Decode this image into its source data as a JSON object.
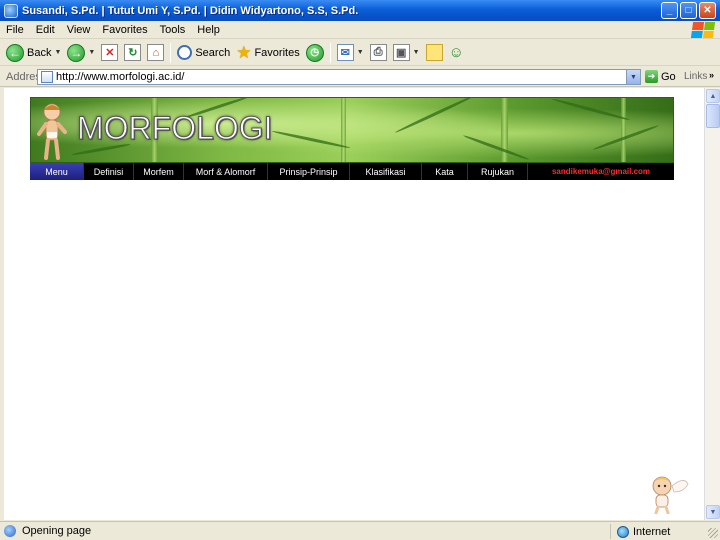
{
  "window": {
    "title": "Susandi, S.Pd. | Tutut Umi Y, S.Pd. | Didin Widyartono, S.S, S.Pd.",
    "minimize": "_",
    "maximize": "□",
    "close": "✕"
  },
  "menubar": [
    "File",
    "Edit",
    "View",
    "Favorites",
    "Tools",
    "Help"
  ],
  "toolbar": {
    "back_label": "Back",
    "search_label": "Search",
    "favorites_label": "Favorites"
  },
  "addressbar": {
    "label": "Address",
    "url": "http://www.morfologi.ac.id/",
    "go_label": "Go",
    "links_label": "Links",
    "links_chevron": "»"
  },
  "page": {
    "banner_title": "MORFOLOGI",
    "nav": [
      {
        "label": "Menu"
      },
      {
        "label": "Definisi"
      },
      {
        "label": "Morfem"
      },
      {
        "label": "Morf & Alomorf"
      },
      {
        "label": "Prinsip-Prinsip"
      },
      {
        "label": "Klasifikasi"
      },
      {
        "label": "Kata"
      },
      {
        "label": "Rujukan"
      },
      {
        "label": "sandikemuka@gmail.com"
      }
    ]
  },
  "statusbar": {
    "text": "Opening page",
    "zone": "Internet"
  },
  "colors": {
    "titlebar": "#0a5fd8",
    "nav_active": "#2a2f9a",
    "email": "#ff2b2b"
  }
}
